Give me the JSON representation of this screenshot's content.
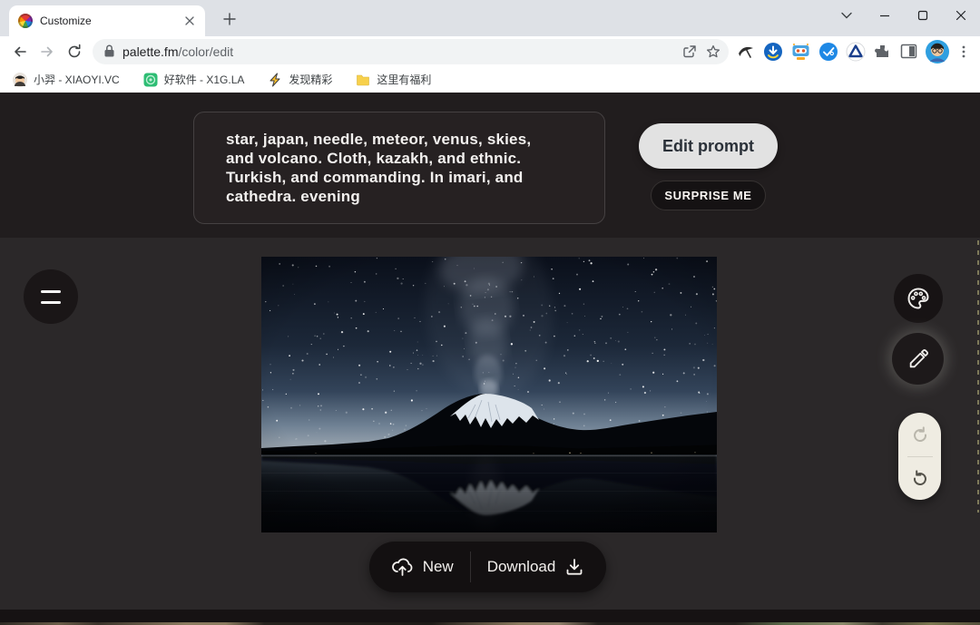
{
  "browser": {
    "tab_title": "Customize",
    "url": {
      "domain": "palette.fm",
      "path": "/color/edit"
    },
    "bookmarks": [
      "小羿 - XIAOYI.VC",
      "好软件 - X1G.LA",
      "发现精彩",
      "这里有福利"
    ]
  },
  "editor": {
    "prompt_lines": [
      "star, japan, needle, meteor, venus, skies,",
      "and volcano. Cloth, kazakh, and ethnic.",
      "Turkish, and commanding. In imari, and",
      "cathedra. evening"
    ],
    "buttons": {
      "edit_prompt": "Edit prompt",
      "surprise_me": "SURPRISE ME",
      "new": "New",
      "download": "Download"
    },
    "image_description": "Milky Way rising over snow-capped Mount Fuji mirrored in a lake at night"
  },
  "colors": {
    "header_bg": "#211d1e",
    "canvas_bg": "#2b2829",
    "dark_pill": "#131011",
    "edit_prompt_bg": "#e2e2e2",
    "history_pill_bg": "#efece2"
  }
}
